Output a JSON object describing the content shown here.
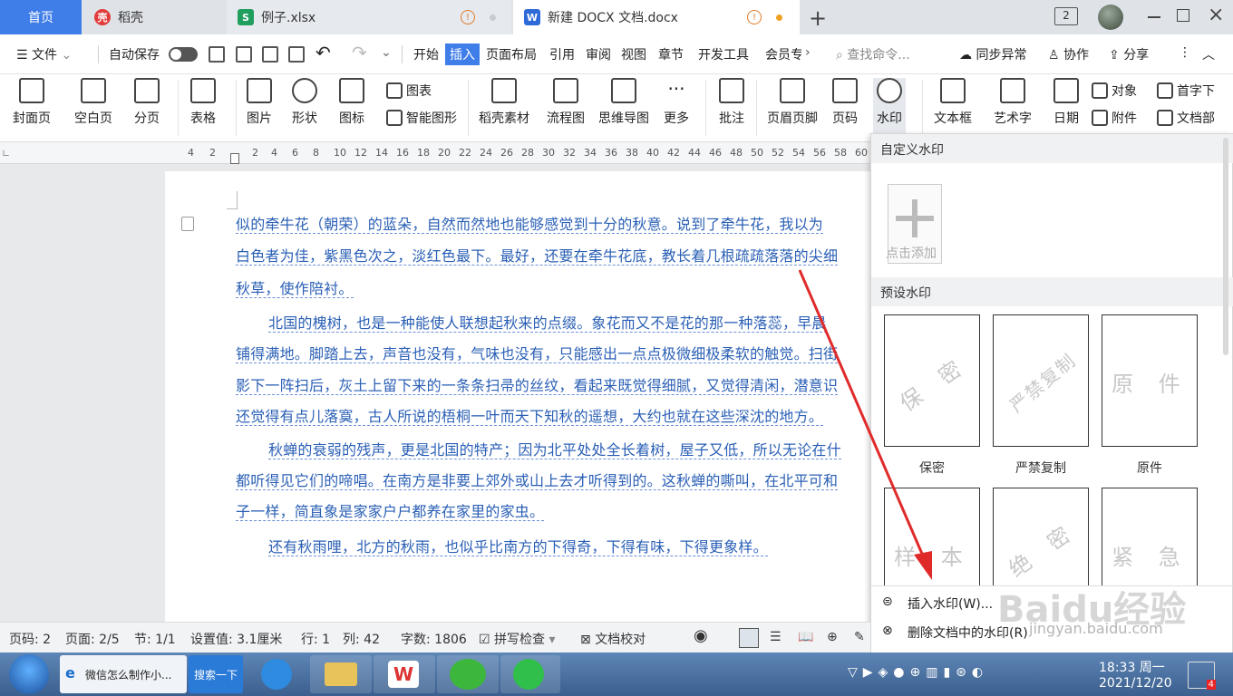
{
  "tabs": {
    "home": "首页",
    "daoke": "稻壳",
    "xlsx": "例子.xlsx",
    "docx": "新建 DOCX 文档.docx"
  },
  "titlebar": {
    "window_count": "2"
  },
  "menu": {
    "file": "文件",
    "autosave": "自动保存",
    "items": [
      "开始",
      "插入",
      "页面布局",
      "引用",
      "审阅",
      "视图",
      "章节",
      "开发工具",
      "会员专"
    ],
    "search": "查找命令...",
    "sync": "同步异常",
    "collab": "协作",
    "share": "分享"
  },
  "ribbon": {
    "cover": "封面页",
    "blank": "空白页",
    "pagebreak": "分页",
    "table": "表格",
    "picture": "图片",
    "shape": "形状",
    "icon": "图标",
    "chart": "图表",
    "smartart": "智能图形",
    "daoke_material": "稻壳素材",
    "flowchart": "流程图",
    "mindmap": "思维导图",
    "more": "更多",
    "comment": "批注",
    "header_footer": "页眉页脚",
    "page_number": "页码",
    "watermark": "水印",
    "textbox": "文本框",
    "wordart": "艺术字",
    "date": "日期",
    "object": "对象",
    "attachment": "附件",
    "dropcap": "首字下",
    "docparts": "文档部"
  },
  "ruler": [
    "4",
    "2",
    "",
    "2",
    "4",
    "6",
    "8",
    "10",
    "12",
    "14",
    "16",
    "18",
    "20",
    "22",
    "24",
    "26",
    "28",
    "30",
    "32",
    "34",
    "36",
    "38",
    "40",
    "42",
    "44",
    "46",
    "48",
    "50",
    "52",
    "54",
    "56",
    "58",
    "60"
  ],
  "doc": {
    "lines": [
      "似的牵牛花（朝荣）的蓝朵，自然而然地也能够感觉到十分的秋意。说到了牵牛花，我以为",
      "白色者为佳，紫黑色次之，淡红色最下。最好，还要在牵牛花底，教长着几根疏疏落落的尖细",
      "秋草，使作陪衬。",
      "北国的槐树，也是一种能使人联想起秋来的点缀。象花而又不是花的那一种落蕊，早晨",
      "铺得满地。脚踏上去，声音也没有，气味也没有，只能感出一点点极微细极柔软的触觉。扫街",
      "影下一阵扫后，灰土上留下来的一条条扫帚的丝纹，看起来既觉得细腻，又觉得清闲，潜意识",
      "还觉得有点儿落寞，古人所说的梧桐一叶而天下知秋的遥想，大约也就在这些深沈的地方。",
      "秋蝉的衰弱的残声，更是北国的特产；因为北平处处全长着树，屋子又低，所以无论在什",
      "都听得见它们的啼唱。在南方是非要上郊外或山上去才听得到的。这秋蝉的嘶叫，在北平可和",
      "子一样，简直象是家家户户都养在家里的家虫。",
      "还有秋雨哩，北方的秋雨，也似乎比南方的下得奇，下得有味，下得更象样。"
    ]
  },
  "watermark_panel": {
    "custom_title": "自定义水印",
    "add_label": "点击添加",
    "preset_title": "预设水印",
    "presets": [
      {
        "text": "保 密",
        "label": "保密"
      },
      {
        "text": "严禁复制",
        "label": "严禁复制"
      },
      {
        "text": "原 件",
        "label": "原件"
      },
      {
        "text": "样 本",
        "label": ""
      },
      {
        "text": "绝 密",
        "label": ""
      },
      {
        "text": "紧 急",
        "label": ""
      }
    ],
    "insert": "插入水印(W)...",
    "delete": "删除文档中的水印(R)"
  },
  "status": {
    "page": "页码: 2",
    "pages": "页面: 2/5",
    "section": "节: 1/1",
    "setting": "设置值: 3.1厘米",
    "row": "行: 1",
    "col": "列: 42",
    "words": "字数: 1806",
    "spell": "拼写检查",
    "proof": "文档校对"
  },
  "taskbar": {
    "ie_task": "微信怎么制作小...",
    "search_btn": "搜索一下",
    "time": "18:33 周一",
    "date": "2021/12/20",
    "notif": "4"
  },
  "watermark_overlay": {
    "brand": "Baidu经验",
    "url": "jingyan.baidu.com"
  }
}
